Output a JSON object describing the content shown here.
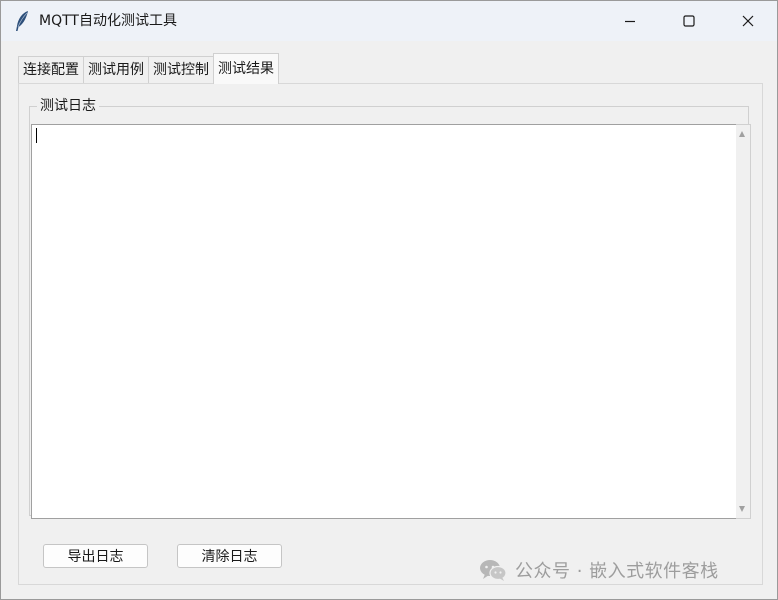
{
  "window": {
    "title": "MQTT自动化测试工具"
  },
  "icons": {
    "app": "feather-icon",
    "minimize": "minimize-icon",
    "maximize": "maximize-icon",
    "close": "close-icon",
    "watermark": "wechat-icon"
  },
  "tabs": [
    {
      "label": "连接配置",
      "active": false
    },
    {
      "label": "测试用例",
      "active": false
    },
    {
      "label": "测试控制",
      "active": false
    },
    {
      "label": "测试结果",
      "active": true
    }
  ],
  "results": {
    "group_label": "测试日志",
    "log_text": "",
    "export_label": "导出日志",
    "clear_label": "清除日志"
  },
  "watermark": {
    "text": "公众号 · 嵌入式软件客栈"
  },
  "colors": {
    "titlebar": "#eef2f8",
    "window_bg": "#f0f0f0",
    "log_bg": "#ffffff"
  }
}
